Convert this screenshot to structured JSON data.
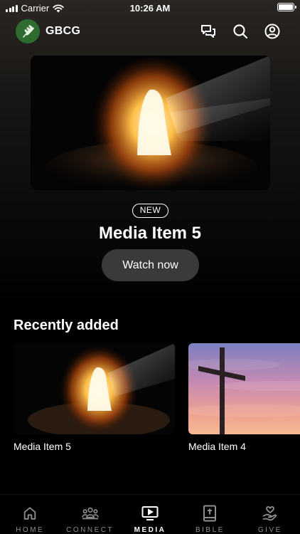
{
  "status_bar": {
    "carrier": "Carrier",
    "time": "10:26 AM"
  },
  "header": {
    "brand": "GBCG",
    "logo_color": "#2e6b2f",
    "actions": [
      "chat-icon",
      "search-icon",
      "profile-icon"
    ]
  },
  "hero": {
    "badge": "NEW",
    "title": "Media Item 5",
    "watch_label": "Watch now"
  },
  "recent": {
    "title": "Recently added",
    "items": [
      {
        "label": "Media Item 5"
      },
      {
        "label": "Media Item 4"
      }
    ]
  },
  "tabs": [
    {
      "label": "HOME",
      "icon": "home-icon"
    },
    {
      "label": "CONNECT",
      "icon": "people-icon"
    },
    {
      "label": "MEDIA",
      "icon": "tv-play-icon"
    },
    {
      "label": "BIBLE",
      "icon": "bible-icon"
    },
    {
      "label": "GIVE",
      "icon": "give-hand-icon"
    }
  ],
  "active_tab": "MEDIA"
}
